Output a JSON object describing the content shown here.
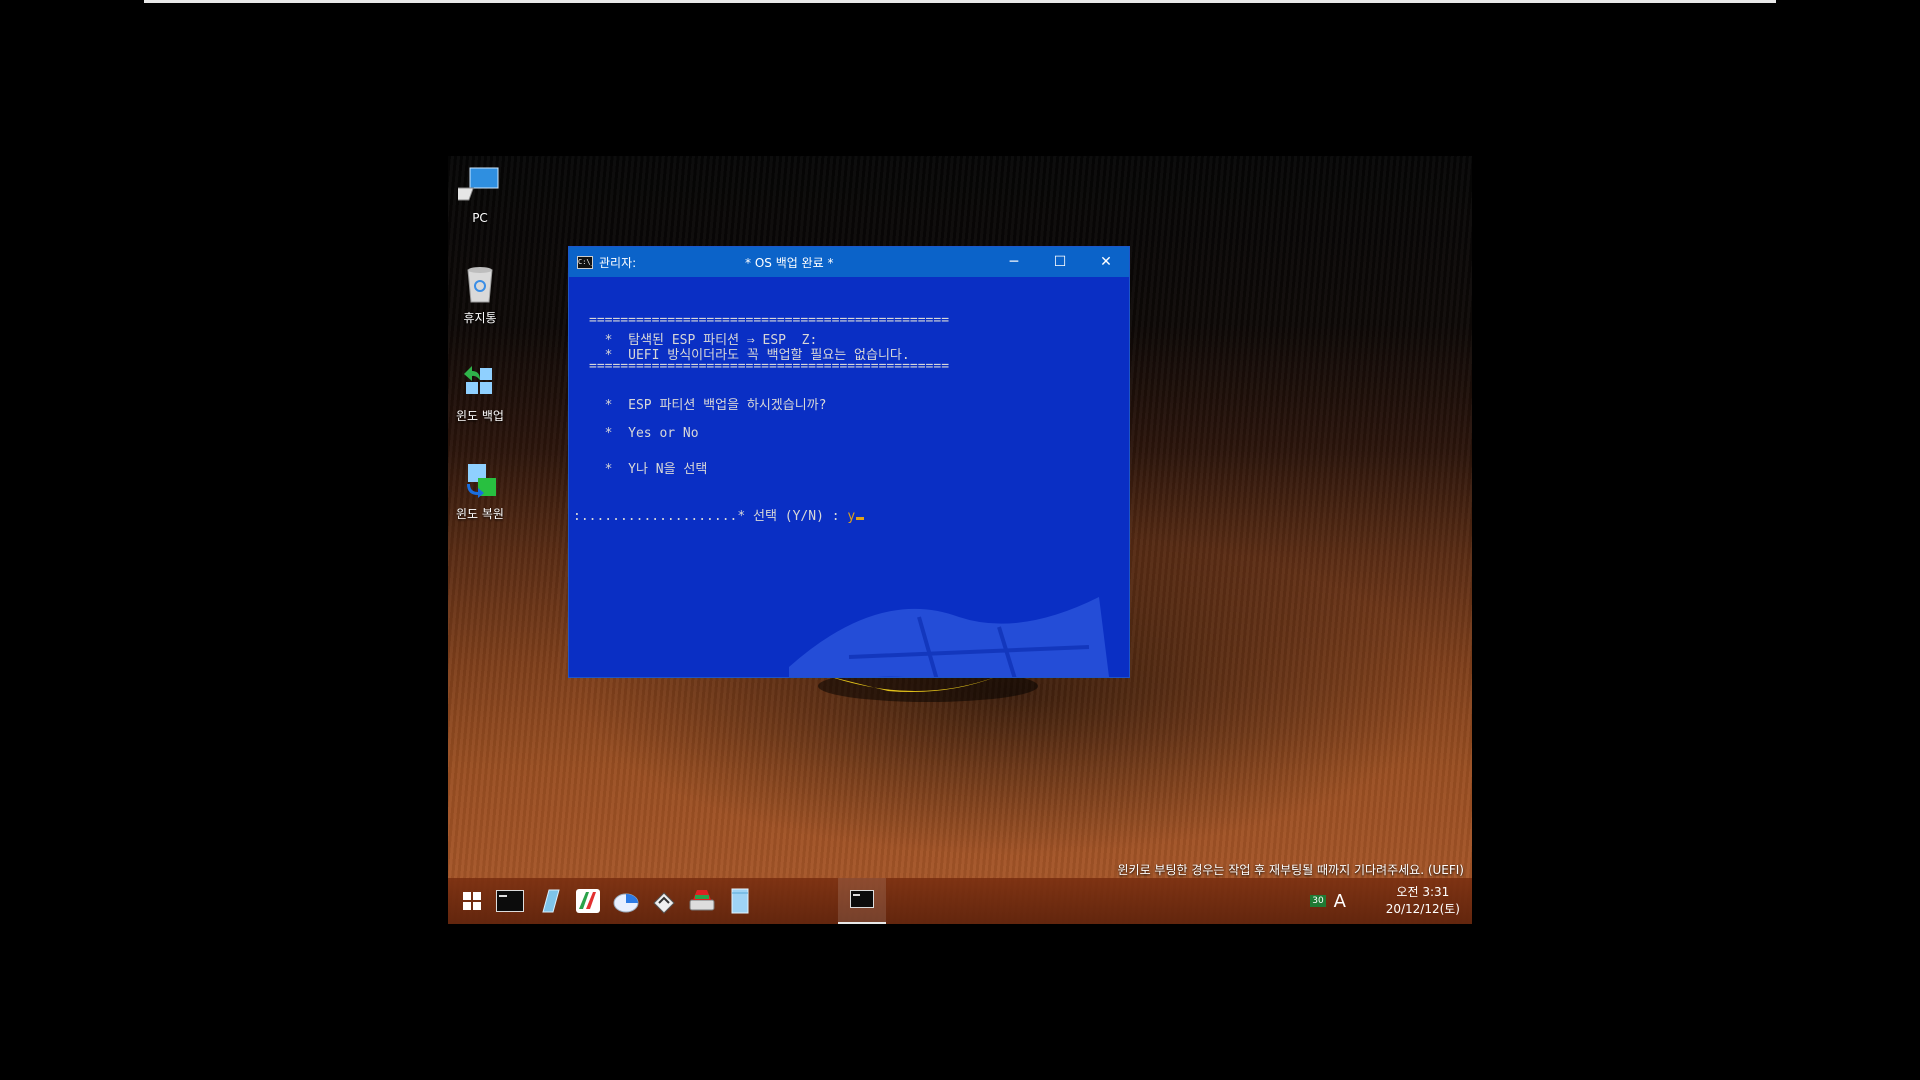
{
  "desktop": {
    "icons": [
      {
        "label": "PC",
        "icon": "computer-icon"
      },
      {
        "label": "휴지통",
        "icon": "recycle-bin-icon"
      },
      {
        "label": "윈도 백업",
        "icon": "backup-icon"
      },
      {
        "label": "윈도 복원",
        "icon": "restore-icon"
      }
    ],
    "hint": "윈키로 부팅한 경우는 작업 후 재부팅될 때까지 기다려주세요. (UEFI)"
  },
  "cmd_window": {
    "title_left": "관리자:",
    "title_center": "* OS 백업 완료 *",
    "lines": [
      "==============================================",
      "  *  탐색된 ESP 파티션 ⇒ ESP  Z:",
      "  *  UEFI 방식이더라도 꼭 백업할 필요는 없습니다.",
      "==============================================",
      "  *  ESP 파티션 백업을 하시겠습니까?",
      "  *  Yes or No",
      "  *  Y나 N을 선택"
    ],
    "prompt": ":....................* 선택 (Y/N) : ",
    "input_value": "y",
    "controls": {
      "minimize": "─",
      "maximize": "☐",
      "close": "✕"
    }
  },
  "taskbar": {
    "apps": [
      "start-icon",
      "cmd-icon",
      "notepad-icon",
      "partition-tool-icon",
      "disk-chart-icon",
      "disk-manager-icon",
      "drive-tool-icon",
      "document-icon"
    ],
    "active_app": "cmd-icon",
    "tray": {
      "badge": "30",
      "ime": "A"
    },
    "clock": {
      "time": "오전 3:31",
      "date": "20/12/12(토)"
    }
  },
  "colors": {
    "console_bg": "#0a2fc4",
    "titlebar": "#0b63c9",
    "cursor": "#e0a21a"
  }
}
